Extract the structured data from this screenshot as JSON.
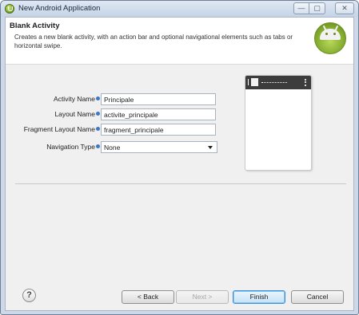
{
  "window": {
    "title": "New Android Application",
    "controls": {
      "minimize": "—",
      "maximize": "▢",
      "close": "✕"
    }
  },
  "header": {
    "title": "Blank Activity",
    "description": "Creates a new blank activity, with an action bar and optional navigational elements such as tabs or horizontal swipe."
  },
  "form": {
    "activity_name": {
      "label": "Activity Name",
      "value": "Principale"
    },
    "layout_name": {
      "label": "Layout Name",
      "value": "activite_principale"
    },
    "fragment_layout_name": {
      "label": "Fragment Layout Name",
      "value": "fragment_principale"
    },
    "navigation_type": {
      "label": "Navigation Type",
      "value": "None"
    }
  },
  "footer": {
    "help": "?",
    "back": "< Back",
    "next": "Next >",
    "finish": "Finish",
    "cancel": "Cancel"
  },
  "colors": {
    "accent": "#3b8fd6",
    "info": "#3a78c8",
    "android_green": "#7da52a"
  }
}
